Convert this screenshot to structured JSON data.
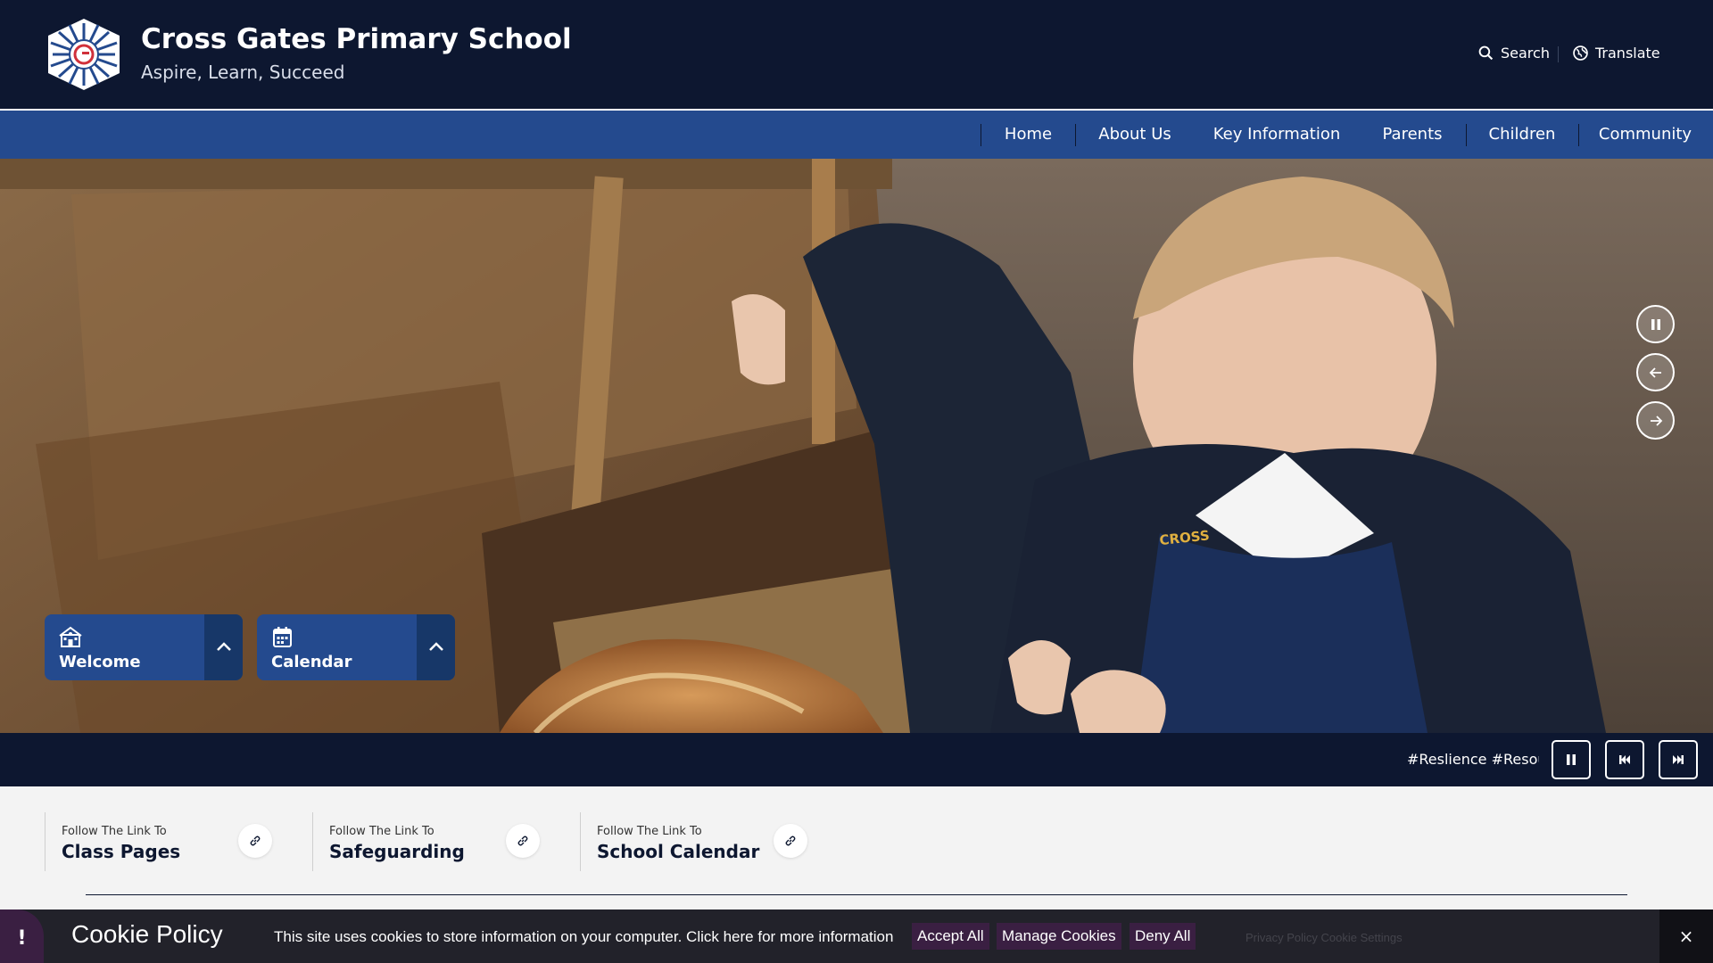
{
  "header": {
    "school_name": "Cross Gates Primary School",
    "motto": "Aspire, Learn, Succeed",
    "search_label": "Search",
    "translate_label": "Translate"
  },
  "nav": {
    "items": [
      {
        "label": "Home"
      },
      {
        "label": "About Us"
      },
      {
        "label": "Key Information"
      },
      {
        "label": "Parents"
      },
      {
        "label": "Children"
      },
      {
        "label": "Community"
      }
    ]
  },
  "hero": {
    "badge_text": "CROSS",
    "panels": [
      {
        "label": "Welcome",
        "icon": "school-icon"
      },
      {
        "label": "Calendar",
        "icon": "calendar-icon"
      }
    ],
    "controls": [
      "pause-icon",
      "arrow-left-icon",
      "arrow-right-icon"
    ]
  },
  "ticker": {
    "text": "#Reslience #Resourc",
    "buttons": [
      "pause-icon",
      "skip-previous-icon",
      "skip-next-icon"
    ]
  },
  "quick_links": [
    {
      "small": "Follow The Link To",
      "title": "Class Pages",
      "icon": "link-icon"
    },
    {
      "small": "Follow The Link To",
      "title": "Safeguarding",
      "icon": "link-icon"
    },
    {
      "small": "Follow The Link To",
      "title": "School Calendar",
      "icon": "link-icon"
    }
  ],
  "cookie": {
    "alert": "!",
    "title": "Cookie Policy",
    "text": "This site uses cookies to store information on your computer. Click here for more information",
    "accept": "Accept All",
    "manage": "Manage Cookies",
    "deny": "Deny All",
    "close": "×",
    "behind_text": "Privacy Policy  Cookie Settings"
  },
  "colors": {
    "header_bg": "#0d1730",
    "nav_bg": "#244a8e",
    "cookie_button_bg": "#3a1f42"
  }
}
